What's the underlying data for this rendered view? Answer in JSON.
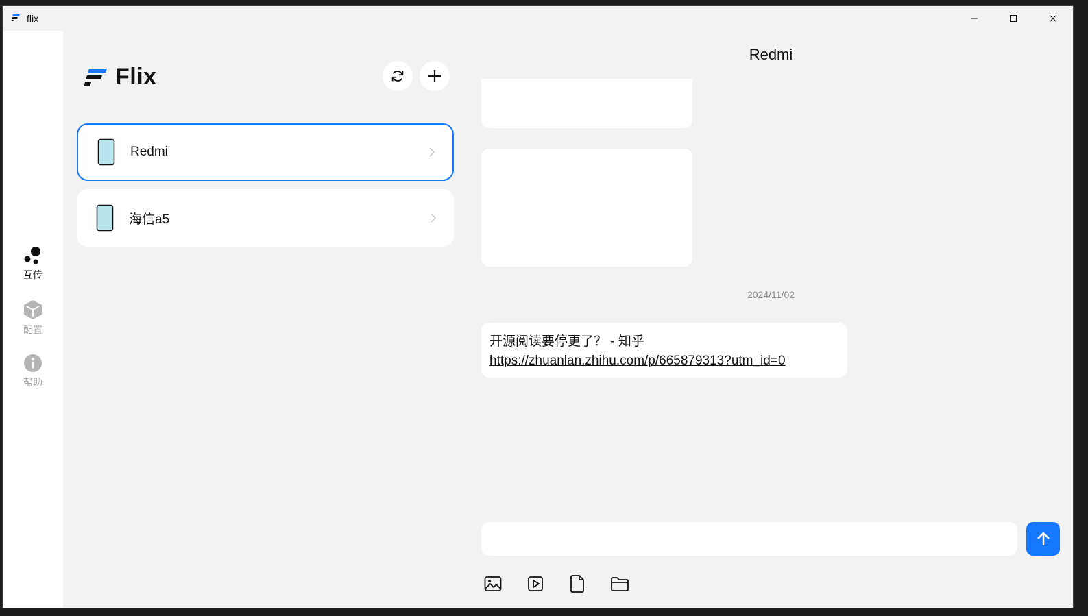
{
  "window": {
    "title": "flix"
  },
  "sidebar": {
    "items": [
      {
        "label": "互传",
        "icon": "transfer-icon",
        "active": true
      },
      {
        "label": "配置",
        "icon": "config-cube-icon",
        "active": false
      },
      {
        "label": "帮助",
        "icon": "info-icon",
        "active": false
      }
    ]
  },
  "brand": {
    "name": "Flix"
  },
  "devices": [
    {
      "name": "Redmi",
      "selected": true
    },
    {
      "name": "海信a5",
      "selected": false
    }
  ],
  "chat": {
    "title": "Redmi",
    "date": "2024/11/02",
    "message": {
      "text": "开源阅读要停更了？ - 知乎",
      "link": "https://zhuanlan.zhihu.com/p/665879313?utm_id=0"
    },
    "input": {
      "value": "",
      "placeholder": ""
    }
  },
  "colors": {
    "accent": "#1677ff",
    "device_icon_fill": "#b8e4ee"
  }
}
